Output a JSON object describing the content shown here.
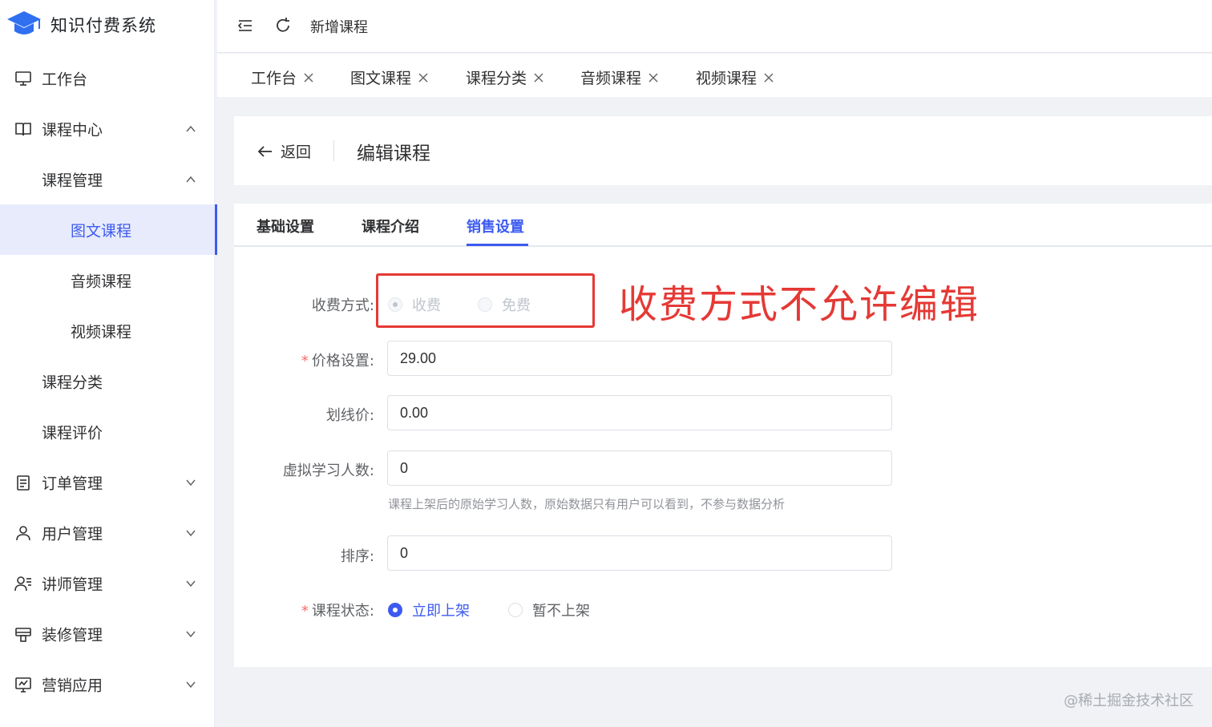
{
  "app": {
    "title": "知识付费系统"
  },
  "sidebar": {
    "items": [
      {
        "label": "工作台",
        "icon": "monitor-icon"
      },
      {
        "label": "课程中心",
        "icon": "book-icon",
        "arrow": "up"
      },
      {
        "label": "课程管理",
        "arrow": "up"
      },
      {
        "label": "图文课程",
        "active": true
      },
      {
        "label": "音频课程"
      },
      {
        "label": "视频课程"
      },
      {
        "label": "课程分类"
      },
      {
        "label": "课程评价"
      },
      {
        "label": "订单管理",
        "icon": "order-icon",
        "arrow": "down"
      },
      {
        "label": "用户管理",
        "icon": "user-icon",
        "arrow": "down"
      },
      {
        "label": "讲师管理",
        "icon": "teacher-icon",
        "arrow": "down"
      },
      {
        "label": "装修管理",
        "icon": "decorate-icon",
        "arrow": "down"
      },
      {
        "label": "营销应用",
        "icon": "marketing-icon",
        "arrow": "down"
      }
    ]
  },
  "topbar": {
    "title": "新增课程"
  },
  "tabs": [
    {
      "label": "工作台"
    },
    {
      "label": "图文课程"
    },
    {
      "label": "课程分类"
    },
    {
      "label": "音频课程"
    },
    {
      "label": "视频课程"
    }
  ],
  "header": {
    "back_label": "返回",
    "title": "编辑课程"
  },
  "form_tabs": [
    {
      "label": "基础设置"
    },
    {
      "label": "课程介绍"
    },
    {
      "label": "销售设置",
      "active": true
    }
  ],
  "form": {
    "fee_type": {
      "label": "收费方式:",
      "options": [
        "收费",
        "免费"
      ],
      "selected": "收费",
      "disabled": true
    },
    "price": {
      "label": "价格设置:",
      "value": "29.00",
      "required": true
    },
    "strike_price": {
      "label": "划线价:",
      "value": "0.00"
    },
    "virtual_learners": {
      "label": "虚拟学习人数:",
      "value": "0",
      "hint": "课程上架后的原始学习人数，原始数据只有用户可以看到，不参与数据分析"
    },
    "sort": {
      "label": "排序:",
      "value": "0"
    },
    "status": {
      "label": "课程状态:",
      "options": [
        "立即上架",
        "暂不上架"
      ],
      "selected": "立即上架",
      "required": true
    }
  },
  "annotation": "收费方式不允许编辑",
  "watermark": "@稀土掘金技术社区",
  "colors": {
    "accent": "#3d5bf0",
    "annotation": "#e53935"
  }
}
